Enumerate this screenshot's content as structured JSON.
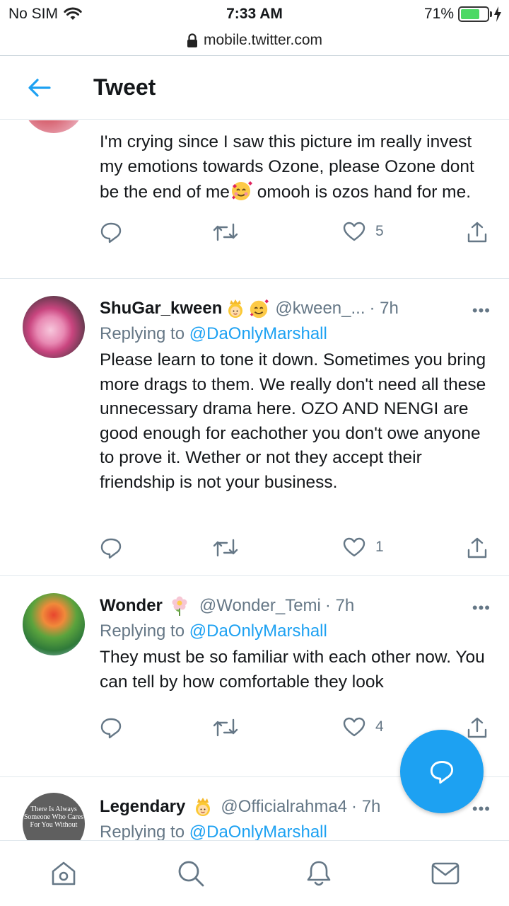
{
  "status_bar": {
    "carrier": "No SIM",
    "time": "7:33 AM",
    "battery_percent": "71%",
    "battery_level": 0.71,
    "url": "mobile.twitter.com"
  },
  "header": {
    "title": "Tweet"
  },
  "tweets": [
    {
      "text": "I'm crying since I saw this picture im really invest my emotions towards Ozone, please Ozone dont be the end of me",
      "text_tail": " omooh is ozos hand for me.",
      "likes": "5",
      "icons": [
        "reply-icon",
        "retweet-icon",
        "heart-icon",
        "share-icon"
      ]
    },
    {
      "name": "ShuGar_kween",
      "name_emojis": [
        "princess-emoji",
        "smiling-face-with-hearts-emoji"
      ],
      "handle": "@kween_...",
      "time": "· 7h",
      "reply_prefix": "Replying to ",
      "reply_to": "@DaOnlyMarshall",
      "text": "Please learn to tone it down. Sometimes you bring more drags to them. We really don't need all these unnecessary drama here. OZO AND NENGI are good enough for eachother you don't owe anyone to prove it. Wether or not they accept their friendship is not your business.",
      "likes": "1"
    },
    {
      "name": "Wonder",
      "name_emojis": [
        "blossom-emoji"
      ],
      "handle": "@Wonder_Temi",
      "time": "· 7h",
      "reply_prefix": "Replying to ",
      "reply_to": "@DaOnlyMarshall",
      "text": "They must be so familiar with each other now. You can tell by how comfortable they look",
      "likes": "4"
    },
    {
      "name": "Legendary",
      "name_emojis": [
        "princess-emoji"
      ],
      "handle": "@Officialrahma4",
      "time": "· 7h",
      "reply_prefix": "Replying to ",
      "reply_to": "@DaOnlyMarshall",
      "avatar_text": "There Is Always Someone Who Cares For You Without"
    }
  ],
  "more_label": "•••",
  "bottom_nav": [
    "home-icon",
    "search-icon",
    "notifications-icon",
    "messages-icon"
  ],
  "colors": {
    "accent": "#1da1f2",
    "secondary_text": "#657786",
    "divider": "#e1e8ed"
  }
}
